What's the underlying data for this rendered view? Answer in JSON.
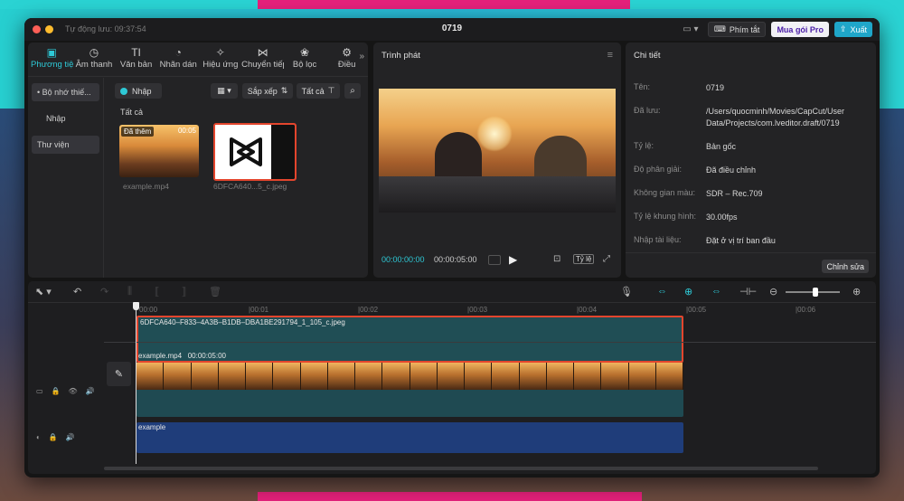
{
  "titlebar": {
    "autosave": "Tự động lưu: 09:37:54",
    "title": "0719",
    "shortcuts_label": "Phím tắt",
    "pro_label": "Mua gói Pro",
    "export_label": "Xuất"
  },
  "media": {
    "tabs": [
      {
        "label": "Phương tiện",
        "icon": "▣"
      },
      {
        "label": "Âm thanh",
        "icon": "◷"
      },
      {
        "label": "Văn bản",
        "icon": "TI"
      },
      {
        "label": "Nhãn dán",
        "icon": "◔"
      },
      {
        "label": "Hiệu ứng",
        "icon": "✧"
      },
      {
        "label": "Chuyển tiếp",
        "icon": "⋈"
      },
      {
        "label": "Bộ lọc",
        "icon": "❀"
      },
      {
        "label": "Điều",
        "icon": "⚙"
      }
    ],
    "more_icon": "»",
    "sidebar": {
      "local_label": "• Bộ nhớ thiế...",
      "import_label": "Nhập",
      "library_label": "Thư viện"
    },
    "toolbar": {
      "import_label": "Nhập",
      "view_label": "▦ ▾",
      "sort_label": "Sắp xếp",
      "filter_label": "Tất cả"
    },
    "all_label": "Tất cả",
    "items": [
      {
        "name": "example.mp4",
        "badge": "Đã thêm",
        "duration": "00:05"
      },
      {
        "name": "6DFCA640...5_c.jpeg"
      }
    ]
  },
  "player": {
    "title": "Trình phát",
    "time_current": "00:00:00:00",
    "time_total": "00:00:05:00",
    "ratio_label": "Tỷ lệ"
  },
  "detail": {
    "title": "Chi tiết",
    "rows": [
      {
        "key": "Tên:",
        "value": "0719"
      },
      {
        "key": "Đã lưu:",
        "value": "/Users/quocminh/Movies/CapCut/User Data/Projects/com.lveditor.draft/0719"
      },
      {
        "key": "Tỷ lệ:",
        "value": "Bản gốc"
      },
      {
        "key": "Độ phân giải:",
        "value": "Đã điều chỉnh"
      },
      {
        "key": "Không gian màu:",
        "value": "SDR – Rec.709"
      },
      {
        "key": "Tỷ lệ khung hình:",
        "value": "30.00fps"
      },
      {
        "key": "Nhập tài liệu:",
        "value": "Đặt ở vị trí ban đầu"
      }
    ],
    "edit_label": "Chỉnh sửa"
  },
  "timeline": {
    "ticks": [
      "00:00",
      "|00:01",
      "|00:02",
      "|00:03",
      "|00:04",
      "|00:05",
      "|00:06"
    ],
    "image_clip_name": "6DFCA640–F833–4A3B–B1DB–DBA1BE291794_1_105_c.jpeg",
    "video_clip_name": "example.mp4",
    "video_clip_duration": "00:00:05:00",
    "audio_clip_name": "example",
    "zoom_level": 0.55
  },
  "colors": {
    "accent": "#2ec9d6",
    "selection_border": "#e3452d",
    "frame_pink": "#e5217b"
  }
}
